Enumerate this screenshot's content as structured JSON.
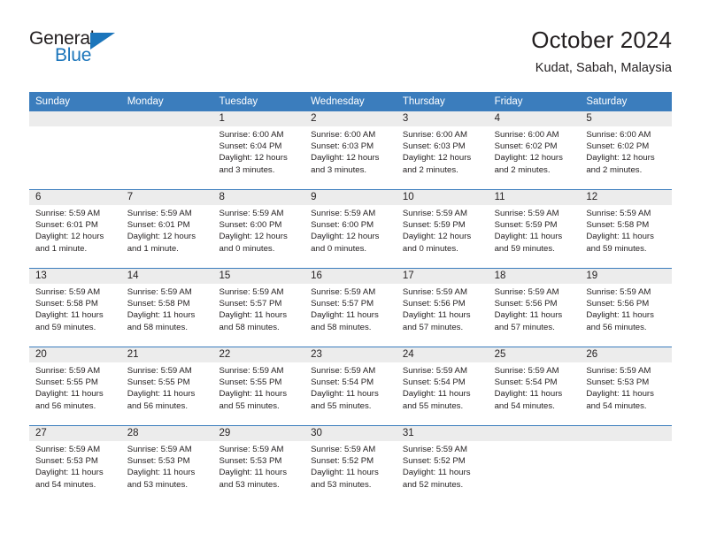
{
  "brand": {
    "name_top": "General",
    "name_bottom": "Blue",
    "accent_color": "#1b75bb"
  },
  "header": {
    "title": "October 2024",
    "subtitle": "Kudat, Sabah, Malaysia"
  },
  "calendar": {
    "header_bg": "#3b7dbd",
    "day_band_bg": "#ececec",
    "weekdays": [
      "Sunday",
      "Monday",
      "Tuesday",
      "Wednesday",
      "Thursday",
      "Friday",
      "Saturday"
    ],
    "weeks": [
      [
        {
          "day": "",
          "lines": []
        },
        {
          "day": "",
          "lines": []
        },
        {
          "day": "1",
          "lines": [
            "Sunrise: 6:00 AM",
            "Sunset: 6:04 PM",
            "Daylight: 12 hours",
            "and 3 minutes."
          ]
        },
        {
          "day": "2",
          "lines": [
            "Sunrise: 6:00 AM",
            "Sunset: 6:03 PM",
            "Daylight: 12 hours",
            "and 3 minutes."
          ]
        },
        {
          "day": "3",
          "lines": [
            "Sunrise: 6:00 AM",
            "Sunset: 6:03 PM",
            "Daylight: 12 hours",
            "and 2 minutes."
          ]
        },
        {
          "day": "4",
          "lines": [
            "Sunrise: 6:00 AM",
            "Sunset: 6:02 PM",
            "Daylight: 12 hours",
            "and 2 minutes."
          ]
        },
        {
          "day": "5",
          "lines": [
            "Sunrise: 6:00 AM",
            "Sunset: 6:02 PM",
            "Daylight: 12 hours",
            "and 2 minutes."
          ]
        }
      ],
      [
        {
          "day": "6",
          "lines": [
            "Sunrise: 5:59 AM",
            "Sunset: 6:01 PM",
            "Daylight: 12 hours",
            "and 1 minute."
          ]
        },
        {
          "day": "7",
          "lines": [
            "Sunrise: 5:59 AM",
            "Sunset: 6:01 PM",
            "Daylight: 12 hours",
            "and 1 minute."
          ]
        },
        {
          "day": "8",
          "lines": [
            "Sunrise: 5:59 AM",
            "Sunset: 6:00 PM",
            "Daylight: 12 hours",
            "and 0 minutes."
          ]
        },
        {
          "day": "9",
          "lines": [
            "Sunrise: 5:59 AM",
            "Sunset: 6:00 PM",
            "Daylight: 12 hours",
            "and 0 minutes."
          ]
        },
        {
          "day": "10",
          "lines": [
            "Sunrise: 5:59 AM",
            "Sunset: 5:59 PM",
            "Daylight: 12 hours",
            "and 0 minutes."
          ]
        },
        {
          "day": "11",
          "lines": [
            "Sunrise: 5:59 AM",
            "Sunset: 5:59 PM",
            "Daylight: 11 hours",
            "and 59 minutes."
          ]
        },
        {
          "day": "12",
          "lines": [
            "Sunrise: 5:59 AM",
            "Sunset: 5:58 PM",
            "Daylight: 11 hours",
            "and 59 minutes."
          ]
        }
      ],
      [
        {
          "day": "13",
          "lines": [
            "Sunrise: 5:59 AM",
            "Sunset: 5:58 PM",
            "Daylight: 11 hours",
            "and 59 minutes."
          ]
        },
        {
          "day": "14",
          "lines": [
            "Sunrise: 5:59 AM",
            "Sunset: 5:58 PM",
            "Daylight: 11 hours",
            "and 58 minutes."
          ]
        },
        {
          "day": "15",
          "lines": [
            "Sunrise: 5:59 AM",
            "Sunset: 5:57 PM",
            "Daylight: 11 hours",
            "and 58 minutes."
          ]
        },
        {
          "day": "16",
          "lines": [
            "Sunrise: 5:59 AM",
            "Sunset: 5:57 PM",
            "Daylight: 11 hours",
            "and 58 minutes."
          ]
        },
        {
          "day": "17",
          "lines": [
            "Sunrise: 5:59 AM",
            "Sunset: 5:56 PM",
            "Daylight: 11 hours",
            "and 57 minutes."
          ]
        },
        {
          "day": "18",
          "lines": [
            "Sunrise: 5:59 AM",
            "Sunset: 5:56 PM",
            "Daylight: 11 hours",
            "and 57 minutes."
          ]
        },
        {
          "day": "19",
          "lines": [
            "Sunrise: 5:59 AM",
            "Sunset: 5:56 PM",
            "Daylight: 11 hours",
            "and 56 minutes."
          ]
        }
      ],
      [
        {
          "day": "20",
          "lines": [
            "Sunrise: 5:59 AM",
            "Sunset: 5:55 PM",
            "Daylight: 11 hours",
            "and 56 minutes."
          ]
        },
        {
          "day": "21",
          "lines": [
            "Sunrise: 5:59 AM",
            "Sunset: 5:55 PM",
            "Daylight: 11 hours",
            "and 56 minutes."
          ]
        },
        {
          "day": "22",
          "lines": [
            "Sunrise: 5:59 AM",
            "Sunset: 5:55 PM",
            "Daylight: 11 hours",
            "and 55 minutes."
          ]
        },
        {
          "day": "23",
          "lines": [
            "Sunrise: 5:59 AM",
            "Sunset: 5:54 PM",
            "Daylight: 11 hours",
            "and 55 minutes."
          ]
        },
        {
          "day": "24",
          "lines": [
            "Sunrise: 5:59 AM",
            "Sunset: 5:54 PM",
            "Daylight: 11 hours",
            "and 55 minutes."
          ]
        },
        {
          "day": "25",
          "lines": [
            "Sunrise: 5:59 AM",
            "Sunset: 5:54 PM",
            "Daylight: 11 hours",
            "and 54 minutes."
          ]
        },
        {
          "day": "26",
          "lines": [
            "Sunrise: 5:59 AM",
            "Sunset: 5:53 PM",
            "Daylight: 11 hours",
            "and 54 minutes."
          ]
        }
      ],
      [
        {
          "day": "27",
          "lines": [
            "Sunrise: 5:59 AM",
            "Sunset: 5:53 PM",
            "Daylight: 11 hours",
            "and 54 minutes."
          ]
        },
        {
          "day": "28",
          "lines": [
            "Sunrise: 5:59 AM",
            "Sunset: 5:53 PM",
            "Daylight: 11 hours",
            "and 53 minutes."
          ]
        },
        {
          "day": "29",
          "lines": [
            "Sunrise: 5:59 AM",
            "Sunset: 5:53 PM",
            "Daylight: 11 hours",
            "and 53 minutes."
          ]
        },
        {
          "day": "30",
          "lines": [
            "Sunrise: 5:59 AM",
            "Sunset: 5:52 PM",
            "Daylight: 11 hours",
            "and 53 minutes."
          ]
        },
        {
          "day": "31",
          "lines": [
            "Sunrise: 5:59 AM",
            "Sunset: 5:52 PM",
            "Daylight: 11 hours",
            "and 52 minutes."
          ]
        },
        {
          "day": "",
          "lines": []
        },
        {
          "day": "",
          "lines": []
        }
      ]
    ]
  }
}
